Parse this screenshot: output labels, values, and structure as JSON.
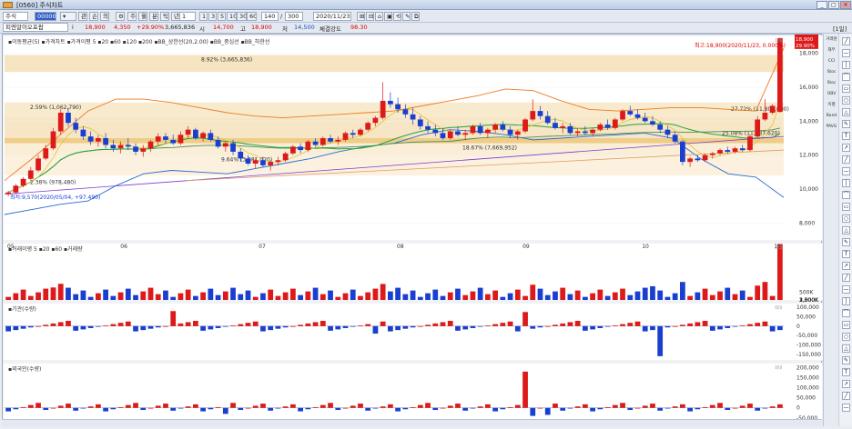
{
  "window": {
    "title": "[0560] 주식차트",
    "unit_label": "[1일]"
  },
  "toolbar": {
    "market": "주식",
    "code": "00000",
    "stock_name": "피엔알이오포팝",
    "nav_buttons": [
      "관",
      "손",
      "의"
    ],
    "periods": [
      "주",
      "월",
      "분",
      "틱",
      "년"
    ],
    "minute_options": [
      "1",
      "3",
      "5",
      "10",
      "30",
      "60"
    ],
    "count_value": "140",
    "count_total": "300",
    "date": "2020/11/23",
    "fields": {
      "price": "18,900",
      "change": "4,350",
      "rate": "+29.90%",
      "volume": "3,665,836",
      "high_label": "고",
      "high": "14,700",
      "low_label": "저",
      "low": "14,500",
      "strength_label": "체결강도",
      "strength": "98.30",
      "info_label": "i",
      "sep_label": "시"
    }
  },
  "legends": {
    "price": "▪이동평균(5) ▪가격차트 ▪가격이평 5 ▪20 ▪60 ▪120 ▪200 ▪BB_상한선(20,2.00) ▪BB_중심선 ▪BB_하한선",
    "volume": "▪거래이평 5 ▪20 ▪60 ▪거래량",
    "inst": "▪기관(수량)",
    "foreign": "▪외국인(수량)"
  },
  "annotations": {
    "high": "최고:18,900(2020/11/23, 0.000%)",
    "low": "최저:9,570(2020/05/04, +97.490)",
    "vp": [
      "8.92% (3,665,836)",
      "2.59% (1,062,790)",
      "2.38% (978,480)",
      "9.64% (3,981,020)",
      "18.67% (7,669,952)",
      "27.72% (11,800,000)",
      "25.08% (11,987,620)"
    ]
  },
  "price_tags": {
    "last": "18,900",
    "rate": "29.90%"
  },
  "axes": {
    "months": [
      "05",
      "06",
      "07",
      "08",
      "09",
      "10",
      "11"
    ],
    "price_ticks": [
      "18,000",
      "16,000",
      "14,000",
      "12,000",
      "10,000",
      "8,000"
    ],
    "vol_ticks": [
      "3,500K",
      "3,000K",
      "2,500K",
      "2,000K",
      "1,500K",
      "1,000K",
      "500K"
    ],
    "inst_ticks": [
      "100,000",
      "50,000",
      "0",
      "-50,000",
      "-100,000",
      "-150,000"
    ],
    "frgn_ticks": [
      "200,000",
      "150,000",
      "100,000",
      "50,000",
      "0",
      "-50,000"
    ],
    "pane_tag": "최대"
  },
  "right_toolbar": [
    "거래원",
    "재무",
    "CCI",
    "Stoc",
    "Stoc",
    "OBV",
    "이평",
    "Band",
    "PAVG"
  ],
  "colors": {
    "up": "#dd1a1a",
    "down": "#1a3fd0",
    "ma5": "#22a53a",
    "bb_up": "#f07a20",
    "bb_low": "#2a6bd8",
    "ma120": "#7a3ad0",
    "ma200": "#e09a60"
  },
  "chart_data": [
    {
      "type": "candlestick",
      "title": "가격차트",
      "ylim": [
        7000,
        19000
      ],
      "categories": [
        "05",
        "06",
        "07",
        "08",
        "09",
        "10",
        "11"
      ],
      "ohlc": [
        [
          9700,
          9900,
          9570,
          9800
        ],
        [
          9800,
          10300,
          9700,
          10200
        ],
        [
          10200,
          10700,
          10100,
          10600
        ],
        [
          10600,
          11300,
          10500,
          11100
        ],
        [
          11100,
          12000,
          11000,
          11800
        ],
        [
          11800,
          12600,
          11700,
          12400
        ],
        [
          12400,
          13600,
          12300,
          13400
        ],
        [
          13400,
          14700,
          13200,
          14500
        ],
        [
          14500,
          14800,
          13700,
          13900
        ],
        [
          13900,
          14200,
          13300,
          13500
        ],
        [
          13500,
          13700,
          12900,
          13100
        ],
        [
          13100,
          13400,
          12600,
          12800
        ],
        [
          12800,
          13200,
          12500,
          13000
        ],
        [
          13000,
          13300,
          12400,
          12600
        ],
        [
          12600,
          12900,
          12200,
          12400
        ],
        [
          12400,
          12800,
          12100,
          12600
        ],
        [
          12600,
          13000,
          12300,
          12500
        ],
        [
          12500,
          12700,
          12000,
          12200
        ],
        [
          12200,
          12600,
          11900,
          12400
        ],
        [
          12400,
          12900,
          12200,
          12800
        ],
        [
          12800,
          13300,
          12600,
          13100
        ],
        [
          13100,
          13300,
          12700,
          12900
        ],
        [
          12900,
          13200,
          12600,
          12700
        ],
        [
          12700,
          13400,
          12600,
          13200
        ],
        [
          13200,
          13700,
          13000,
          13500
        ],
        [
          13500,
          13600,
          12900,
          13000
        ],
        [
          13000,
          13400,
          12800,
          13300
        ],
        [
          13300,
          13500,
          12800,
          12900
        ],
        [
          12900,
          13100,
          12400,
          12500
        ],
        [
          12500,
          12800,
          12200,
          12700
        ],
        [
          12700,
          12900,
          12000,
          12200
        ],
        [
          12200,
          12400,
          11600,
          11800
        ],
        [
          11800,
          12000,
          11400,
          11500
        ],
        [
          11500,
          11800,
          11200,
          11700
        ],
        [
          11700,
          11900,
          11300,
          11400
        ],
        [
          11400,
          11700,
          11100,
          11600
        ],
        [
          11600,
          11900,
          11400,
          11700
        ],
        [
          11700,
          12200,
          11600,
          12100
        ],
        [
          12100,
          12600,
          12000,
          12500
        ],
        [
          12500,
          12700,
          12100,
          12300
        ],
        [
          12300,
          12900,
          12200,
          12800
        ],
        [
          12800,
          13000,
          12500,
          12600
        ],
        [
          12600,
          13100,
          12500,
          13000
        ],
        [
          13000,
          13200,
          12700,
          12800
        ],
        [
          12800,
          13100,
          12600,
          12900
        ],
        [
          12900,
          13400,
          12800,
          13300
        ],
        [
          13300,
          13500,
          13000,
          13200
        ],
        [
          13200,
          13600,
          13100,
          13500
        ],
        [
          13500,
          14000,
          13400,
          13900
        ],
        [
          13900,
          14300,
          13700,
          14200
        ],
        [
          14200,
          16300,
          14100,
          15200
        ],
        [
          15200,
          15700,
          14800,
          15000
        ],
        [
          15000,
          15400,
          14500,
          14700
        ],
        [
          14700,
          15000,
          14200,
          14400
        ],
        [
          14400,
          14800,
          13800,
          14100
        ],
        [
          14100,
          14300,
          13500,
          13700
        ],
        [
          13700,
          14000,
          13300,
          13500
        ],
        [
          13500,
          13800,
          13100,
          13300
        ],
        [
          13300,
          13600,
          12900,
          13000
        ],
        [
          13000,
          13500,
          12900,
          13400
        ],
        [
          13400,
          13700,
          13100,
          13200
        ],
        [
          13200,
          13500,
          12900,
          13300
        ],
        [
          13300,
          13800,
          13200,
          13700
        ],
        [
          13700,
          13900,
          13200,
          13300
        ],
        [
          13300,
          13600,
          13000,
          13500
        ],
        [
          13500,
          13900,
          13300,
          13800
        ],
        [
          13800,
          14000,
          13400,
          13500
        ],
        [
          13500,
          13700,
          13000,
          13200
        ],
        [
          13200,
          13500,
          12900,
          13400
        ],
        [
          13400,
          14200,
          13300,
          14100
        ],
        [
          14100,
          15300,
          14000,
          14600
        ],
        [
          14600,
          14900,
          14100,
          14300
        ],
        [
          14300,
          14600,
          13800,
          13900
        ],
        [
          13900,
          14200,
          13500,
          13600
        ],
        [
          13600,
          13900,
          13300,
          13700
        ],
        [
          13700,
          13900,
          13200,
          13300
        ],
        [
          13300,
          13600,
          13100,
          13400
        ],
        [
          13400,
          13700,
          13200,
          13300
        ],
        [
          13300,
          13600,
          13100,
          13500
        ],
        [
          13500,
          13900,
          13400,
          13800
        ],
        [
          13800,
          14100,
          13500,
          13600
        ],
        [
          13600,
          14200,
          13500,
          14100
        ],
        [
          14100,
          14700,
          14000,
          14600
        ],
        [
          14600,
          14900,
          14300,
          14400
        ],
        [
          14400,
          14700,
          14100,
          14200
        ],
        [
          14200,
          14500,
          13900,
          14000
        ],
        [
          14000,
          14300,
          13700,
          13800
        ],
        [
          13800,
          14000,
          13300,
          13500
        ],
        [
          13500,
          13700,
          13000,
          13200
        ],
        [
          13200,
          13400,
          12700,
          12800
        ],
        [
          12800,
          12900,
          11400,
          11600
        ],
        [
          11600,
          11900,
          11300,
          11800
        ],
        [
          11800,
          12000,
          11600,
          11700
        ],
        [
          11700,
          12100,
          11600,
          12000
        ],
        [
          12000,
          12200,
          11800,
          12100
        ],
        [
          12100,
          12400,
          12000,
          12300
        ],
        [
          12300,
          12500,
          12100,
          12200
        ],
        [
          12200,
          12500,
          12100,
          12400
        ],
        [
          12400,
          12600,
          12200,
          12300
        ],
        [
          12300,
          13200,
          12200,
          13100
        ],
        [
          13100,
          14300,
          13000,
          14100
        ],
        [
          14100,
          15300,
          14000,
          14500
        ],
        [
          14500,
          15000,
          14400,
          14900
        ],
        [
          14550,
          18900,
          14500,
          18900
        ]
      ],
      "series": [
        {
          "name": "BB_상한선",
          "values": [
            10500,
            11800,
            13200,
            14600,
            15300,
            15300,
            15100,
            14800,
            14500,
            14300,
            14200,
            14300,
            14400,
            14500,
            14600,
            14900,
            15200,
            15500,
            15900,
            15800,
            15200,
            14700,
            14600,
            14700,
            14800,
            14800,
            14700,
            14600,
            18300
          ]
        },
        {
          "name": "BB_하한선",
          "values": [
            8500,
            8800,
            9100,
            9300,
            10200,
            10900,
            11100,
            11000,
            10900,
            11200,
            11500,
            11800,
            12200,
            12500,
            12700,
            13200,
            13500,
            13400,
            13200,
            12900,
            13000,
            13100,
            13200,
            13300,
            13000,
            11800,
            10900,
            10700,
            9500
          ]
        }
      ]
    },
    {
      "type": "bar",
      "title": "거래량",
      "ylim": [
        0,
        3700000
      ],
      "values": [
        800000,
        1200000,
        900000,
        600000,
        300000,
        200000
      ]
    },
    {
      "type": "bar",
      "title": "기관(수량)",
      "ylim": [
        -180000,
        120000
      ]
    },
    {
      "type": "bar",
      "title": "외국인(수량)",
      "ylim": [
        -60000,
        220000
      ]
    }
  ]
}
